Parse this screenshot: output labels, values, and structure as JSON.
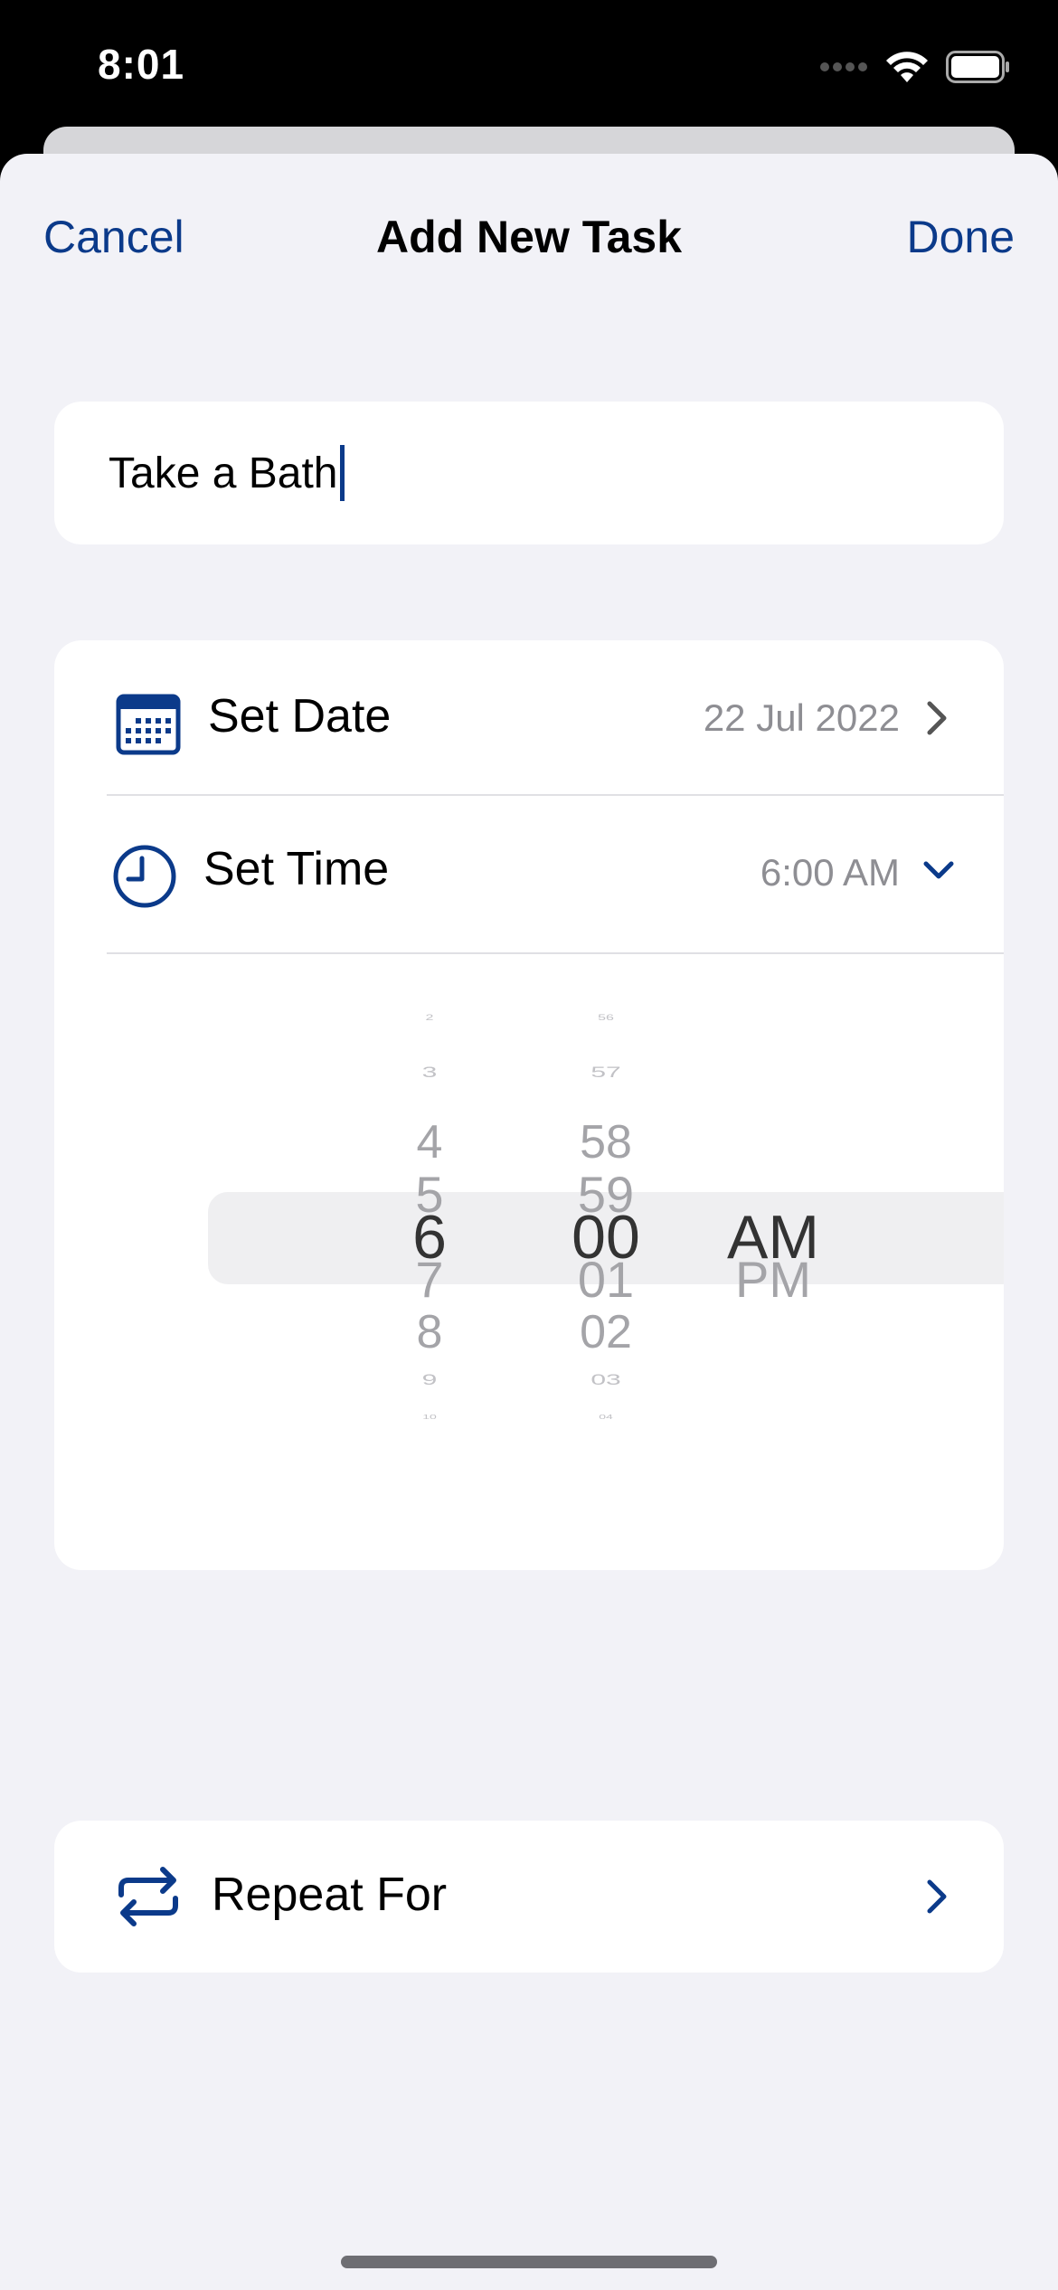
{
  "status_bar": {
    "time": "8:01"
  },
  "nav": {
    "cancel_label": "Cancel",
    "title": "Add New Task",
    "done_label": "Done"
  },
  "task": {
    "title_value": "Take a Bath"
  },
  "date_row": {
    "label": "Set Date",
    "value": "22 Jul 2022",
    "icon": "calendar-icon",
    "chevron": "chevron-right-icon"
  },
  "time_row": {
    "label": "Set Time",
    "value": "6:00 AM",
    "icon": "clock-icon",
    "chevron": "chevron-down-icon"
  },
  "picker": {
    "hours": [
      "2",
      "3",
      "4",
      "5",
      "6",
      "7",
      "8",
      "9",
      "10"
    ],
    "minutes": [
      "56",
      "57",
      "58",
      "59",
      "00",
      "01",
      "02",
      "03",
      "04"
    ],
    "periods": [
      "AM",
      "PM"
    ],
    "selected": {
      "hour": "6",
      "minute": "00",
      "period": "AM"
    }
  },
  "repeat_row": {
    "label": "Repeat For",
    "icon": "repeat-icon",
    "chevron": "chevron-right-icon"
  },
  "colors": {
    "accent": "#0b3a8a",
    "background": "#f2f2f7",
    "card": "#ffffff",
    "secondary_text": "#8e8e93"
  }
}
